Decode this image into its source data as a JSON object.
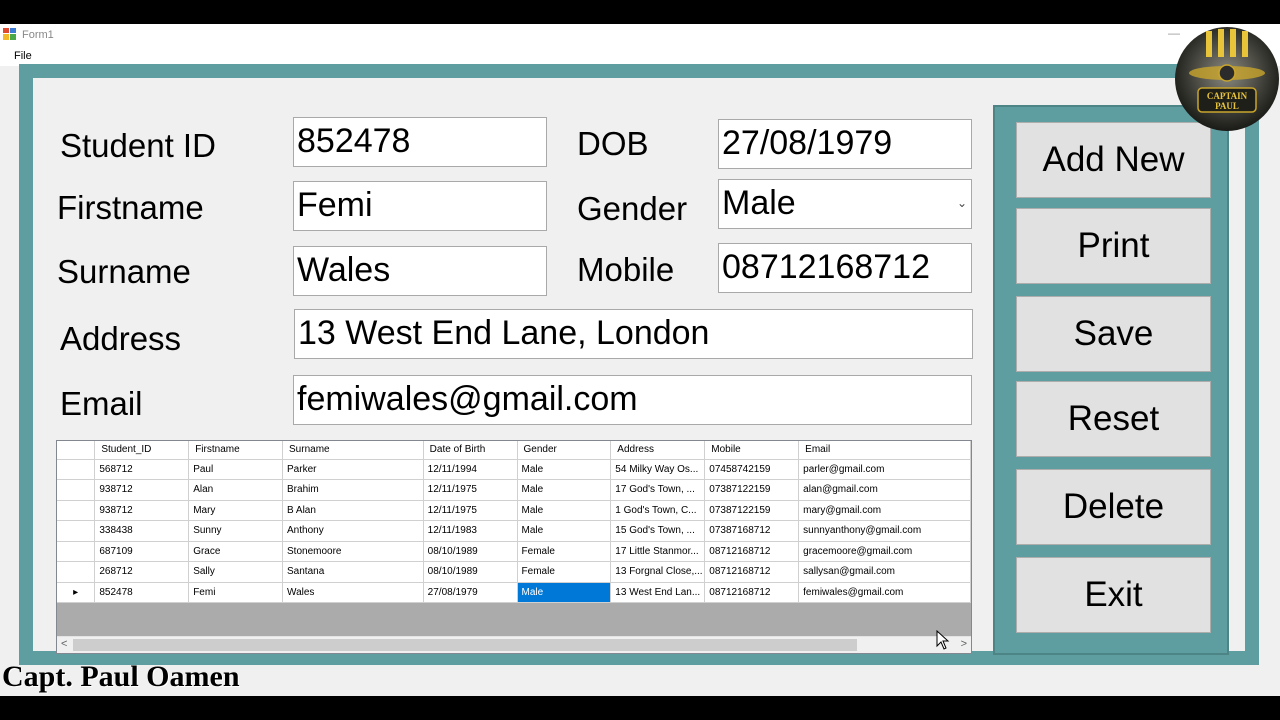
{
  "window": {
    "title": "Form1",
    "minimize_glyph": "—"
  },
  "menu": {
    "file_label": "File"
  },
  "form": {
    "student_id_label": "Student ID",
    "student_id_value": "852478",
    "firstname_label": "Firstname",
    "firstname_value": "Femi",
    "surname_label": "Surname",
    "surname_value": "Wales",
    "address_label": "Address",
    "address_value": "13 West End Lane, London",
    "email_label": "Email",
    "email_value": "femiwales@gmail.com",
    "dob_label": "DOB",
    "dob_value": "27/08/1979",
    "gender_label": "Gender",
    "gender_value": "Male",
    "mobile_label": "Mobile",
    "mobile_value": "08712168712"
  },
  "grid": {
    "columns": [
      "Student_ID",
      "Firstname",
      "Surname",
      "Date of Birth",
      "Gender",
      "Address",
      "Mobile",
      "Email"
    ],
    "current_row_marker": "▸",
    "selected_cell": {
      "row": 6,
      "column": 4
    },
    "rows": [
      [
        "568712",
        "Paul",
        "Parker",
        "12/11/1994",
        "Male",
        "54 Milky Way Os...",
        "07458742159",
        "parler@gmail.com"
      ],
      [
        "938712",
        "Alan",
        "Brahim",
        "12/11/1975",
        "Male",
        "17 God's Town, ...",
        "07387122159",
        "alan@gmail.com"
      ],
      [
        "938712",
        "Mary",
        "B Alan",
        "12/11/1975",
        "Male",
        "1 God's Town, C...",
        "07387122159",
        "mary@gmail.com"
      ],
      [
        "338438",
        "Sunny",
        "Anthony",
        "12/11/1983",
        "Male",
        "15 God's Town, ...",
        "07387168712",
        "sunnyanthony@gmail.com"
      ],
      [
        "687109",
        "Grace",
        "Stonemoore",
        "08/10/1989",
        "Female",
        "17 Little Stanmor...",
        "08712168712",
        "gracemoore@gmail.com"
      ],
      [
        "268712",
        "Sally",
        "Santana",
        "08/10/1989",
        "Female",
        "13 Forgnal Close,...",
        "08712168712",
        "sallysan@gmail.com"
      ],
      [
        "852478",
        "Femi",
        "Wales",
        "27/08/1979",
        "Male",
        "13 West End Lan...",
        "08712168712",
        "femiwales@gmail.com"
      ]
    ],
    "scroll_left": "<",
    "scroll_right": ">"
  },
  "buttons": {
    "add_new": "Add New",
    "print": "Print",
    "save": "Save",
    "reset": "Reset",
    "delete": "Delete",
    "exit": "Exit"
  },
  "logo": {
    "text_line1": "CAPTAIN",
    "text_line2": "PAUL"
  },
  "watermark": "Capt. Paul Oamen",
  "colors": {
    "frame": "#5f9ea0",
    "selection": "#0078d7",
    "button_face": "#e1e1e1"
  },
  "icons": {
    "app": "form-app-icon",
    "gender_dropdown": "chevron-down-icon",
    "cursor": "mouse-pointer-icon"
  }
}
